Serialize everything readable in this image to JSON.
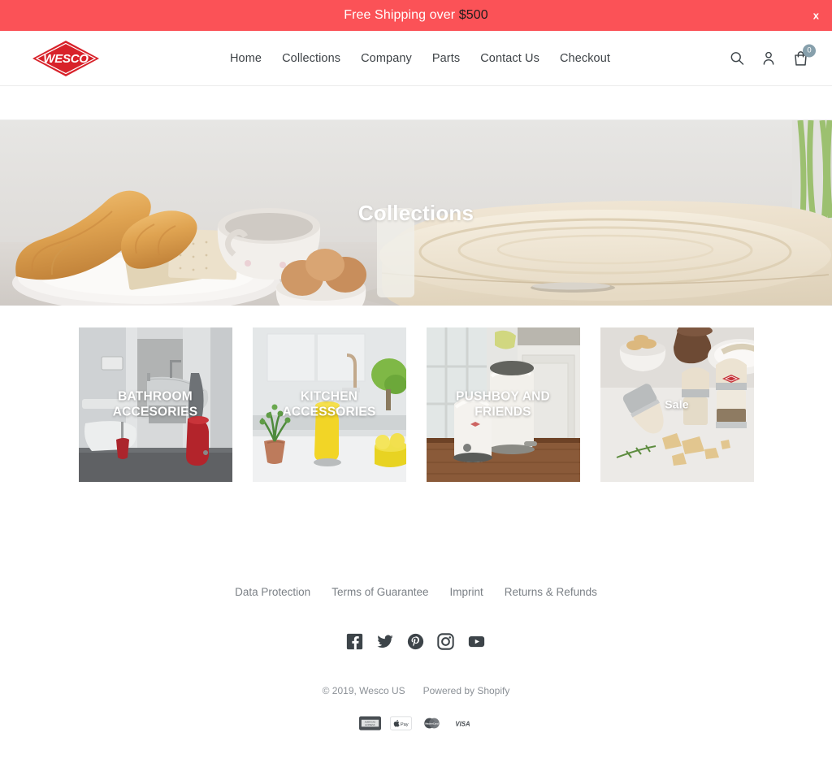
{
  "announcement": {
    "text_before": "Free Shipping over ",
    "amount": "$500",
    "close_label": "x",
    "bg_color": "#fb5257"
  },
  "header": {
    "logo_text": "WESCO",
    "logo_color": "#d8222a",
    "nav": [
      {
        "label": "Home",
        "name": "nav-item-home"
      },
      {
        "label": "Collections",
        "name": "nav-item-collections"
      },
      {
        "label": "Company",
        "name": "nav-item-company"
      },
      {
        "label": "Parts",
        "name": "nav-item-parts"
      },
      {
        "label": "Contact Us",
        "name": "nav-item-contact-us"
      },
      {
        "label": "Checkout",
        "name": "nav-item-checkout"
      }
    ],
    "icons": {
      "search": "search-icon",
      "account": "account-icon",
      "cart": "cart-icon"
    },
    "cart_count": "0",
    "cart_badge_color": "#87a0ac"
  },
  "hero": {
    "title": "Collections"
  },
  "collections": [
    {
      "label": "BATHROOM ACCESORIES",
      "name": "collection-card-bathroom-accesories",
      "size": "large"
    },
    {
      "label": "KITCHEN ACCESSORIES",
      "name": "collection-card-kitchen-accessories",
      "size": "large"
    },
    {
      "label": "PUSHBOY AND FRIENDS",
      "name": "collection-card-pushboy-and-friends",
      "size": "large"
    },
    {
      "label": "Sale",
      "name": "collection-card-sale",
      "size": "small"
    }
  ],
  "footer": {
    "links": [
      {
        "label": "Data Protection",
        "name": "footer-link-data-protection"
      },
      {
        "label": "Terms of Guarantee",
        "name": "footer-link-terms-of-guarantee"
      },
      {
        "label": "Imprint",
        "name": "footer-link-imprint"
      },
      {
        "label": "Returns & Refunds",
        "name": "footer-link-returns-refunds"
      }
    ],
    "social": [
      {
        "name": "facebook-icon"
      },
      {
        "name": "twitter-icon"
      },
      {
        "name": "pinterest-icon"
      },
      {
        "name": "instagram-icon"
      },
      {
        "name": "youtube-icon"
      }
    ],
    "copyright": "© 2019, Wesco US",
    "powered_by": "Powered by Shopify",
    "payments": [
      {
        "name": "american-express-icon",
        "label": "AMERICAN EXPRESS"
      },
      {
        "name": "apple-pay-icon",
        "label": "Pay"
      },
      {
        "name": "mastercard-icon",
        "label": "MasterCard"
      },
      {
        "name": "visa-icon",
        "label": "VISA"
      }
    ]
  }
}
